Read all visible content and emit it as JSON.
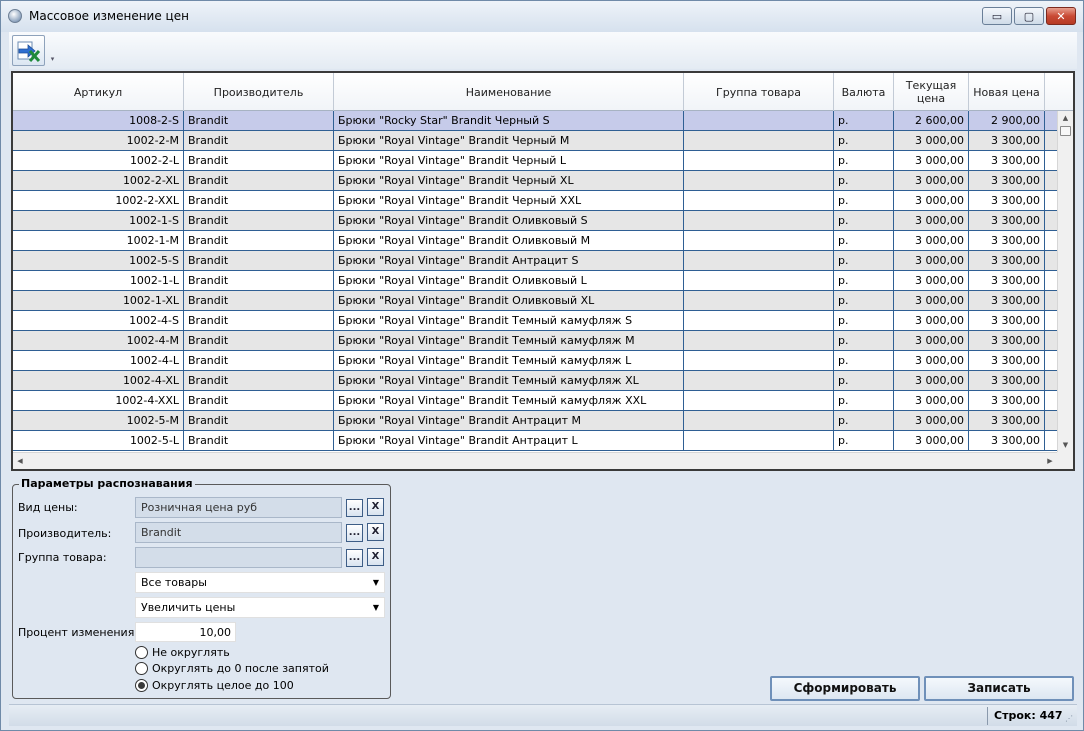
{
  "window": {
    "title": "Массовое изменение цен",
    "buttons": {
      "minimize": "▭",
      "maximize": "▢",
      "close": "✕"
    }
  },
  "toolbar": {
    "export_icon": "export-excel-icon",
    "dropdown_glyph": "▾"
  },
  "grid": {
    "columns": [
      {
        "key": "article",
        "label": "Артикул"
      },
      {
        "key": "maker",
        "label": "Производитель"
      },
      {
        "key": "name",
        "label": "Наименование"
      },
      {
        "key": "group",
        "label": "Группа товара"
      },
      {
        "key": "currency",
        "label": "Валюта"
      },
      {
        "key": "current_price",
        "label": "Текущая цена"
      },
      {
        "key": "new_price",
        "label": "Новая цена"
      }
    ],
    "rows": [
      {
        "article": "1008-2-S",
        "maker": "Brandit",
        "name": "Брюки \"Rocky Star\" Brandit Черный S",
        "group": "",
        "currency": "р.",
        "current_price": "2 600,00",
        "new_price": "2 900,00"
      },
      {
        "article": "1002-2-M",
        "maker": "Brandit",
        "name": "Брюки \"Royal Vintage\" Brandit Черный M",
        "group": "",
        "currency": "р.",
        "current_price": "3 000,00",
        "new_price": "3 300,00"
      },
      {
        "article": "1002-2-L",
        "maker": "Brandit",
        "name": "Брюки \"Royal Vintage\" Brandit Черный L",
        "group": "",
        "currency": "р.",
        "current_price": "3 000,00",
        "new_price": "3 300,00"
      },
      {
        "article": "1002-2-XL",
        "maker": "Brandit",
        "name": "Брюки \"Royal Vintage\" Brandit Черный XL",
        "group": "",
        "currency": "р.",
        "current_price": "3 000,00",
        "new_price": "3 300,00"
      },
      {
        "article": "1002-2-XXL",
        "maker": "Brandit",
        "name": "Брюки \"Royal Vintage\" Brandit Черный XXL",
        "group": "",
        "currency": "р.",
        "current_price": "3 000,00",
        "new_price": "3 300,00"
      },
      {
        "article": "1002-1-S",
        "maker": "Brandit",
        "name": "Брюки \"Royal Vintage\" Brandit Оливковый S",
        "group": "",
        "currency": "р.",
        "current_price": "3 000,00",
        "new_price": "3 300,00"
      },
      {
        "article": "1002-1-M",
        "maker": "Brandit",
        "name": "Брюки \"Royal Vintage\" Brandit Оливковый M",
        "group": "",
        "currency": "р.",
        "current_price": "3 000,00",
        "new_price": "3 300,00"
      },
      {
        "article": "1002-5-S",
        "maker": "Brandit",
        "name": "Брюки \"Royal Vintage\" Brandit Антрацит S",
        "group": "",
        "currency": "р.",
        "current_price": "3 000,00",
        "new_price": "3 300,00"
      },
      {
        "article": "1002-1-L",
        "maker": "Brandit",
        "name": "Брюки \"Royal Vintage\" Brandit Оливковый L",
        "group": "",
        "currency": "р.",
        "current_price": "3 000,00",
        "new_price": "3 300,00"
      },
      {
        "article": "1002-1-XL",
        "maker": "Brandit",
        "name": "Брюки \"Royal Vintage\" Brandit Оливковый XL",
        "group": "",
        "currency": "р.",
        "current_price": "3 000,00",
        "new_price": "3 300,00"
      },
      {
        "article": "1002-4-S",
        "maker": "Brandit",
        "name": "Брюки \"Royal Vintage\" Brandit Темный камуфляж S",
        "group": "",
        "currency": "р.",
        "current_price": "3 000,00",
        "new_price": "3 300,00"
      },
      {
        "article": "1002-4-M",
        "maker": "Brandit",
        "name": "Брюки \"Royal Vintage\" Brandit Темный камуфляж M",
        "group": "",
        "currency": "р.",
        "current_price": "3 000,00",
        "new_price": "3 300,00"
      },
      {
        "article": "1002-4-L",
        "maker": "Brandit",
        "name": "Брюки \"Royal Vintage\" Brandit Темный камуфляж L",
        "group": "",
        "currency": "р.",
        "current_price": "3 000,00",
        "new_price": "3 300,00"
      },
      {
        "article": "1002-4-XL",
        "maker": "Brandit",
        "name": "Брюки \"Royal Vintage\" Brandit Темный камуфляж XL",
        "group": "",
        "currency": "р.",
        "current_price": "3 000,00",
        "new_price": "3 300,00"
      },
      {
        "article": "1002-4-XXL",
        "maker": "Brandit",
        "name": "Брюки \"Royal Vintage\" Brandit Темный камуфляж XXL",
        "group": "",
        "currency": "р.",
        "current_price": "3 000,00",
        "new_price": "3 300,00"
      },
      {
        "article": "1002-5-M",
        "maker": "Brandit",
        "name": "Брюки \"Royal Vintage\" Brandit Антрацит M",
        "group": "",
        "currency": "р.",
        "current_price": "3 000,00",
        "new_price": "3 300,00"
      },
      {
        "article": "1002-5-L",
        "maker": "Brandit",
        "name": "Брюки \"Royal Vintage\" Brandit Антрацит L",
        "group": "",
        "currency": "р.",
        "current_price": "3 000,00",
        "new_price": "3 300,00"
      }
    ],
    "selected_row": 0
  },
  "params": {
    "legend": "Параметры распознавания",
    "price_type_label": "Вид цены:",
    "price_type_value": "Розничная цена руб",
    "maker_label": "Производитель:",
    "maker_value": "Brandit",
    "group_label": "Группа товара:",
    "group_value": "",
    "browse_glyph": "...",
    "clear_glyph": "X",
    "scope_value": "Все товары",
    "action_value": "Увеличить цены",
    "percent_label": "Процент изменения:",
    "percent_value": "10,00",
    "rounding_options": [
      {
        "label": "Не округлять",
        "checked": false
      },
      {
        "label": "Округлять до 0 после запятой",
        "checked": false
      },
      {
        "label": "Округлять целое до 100",
        "checked": true
      }
    ]
  },
  "actions": {
    "generate_label": "Сформировать",
    "save_label": "Записать"
  },
  "status": {
    "rows_label": "Строк:",
    "rows_count": "447"
  }
}
